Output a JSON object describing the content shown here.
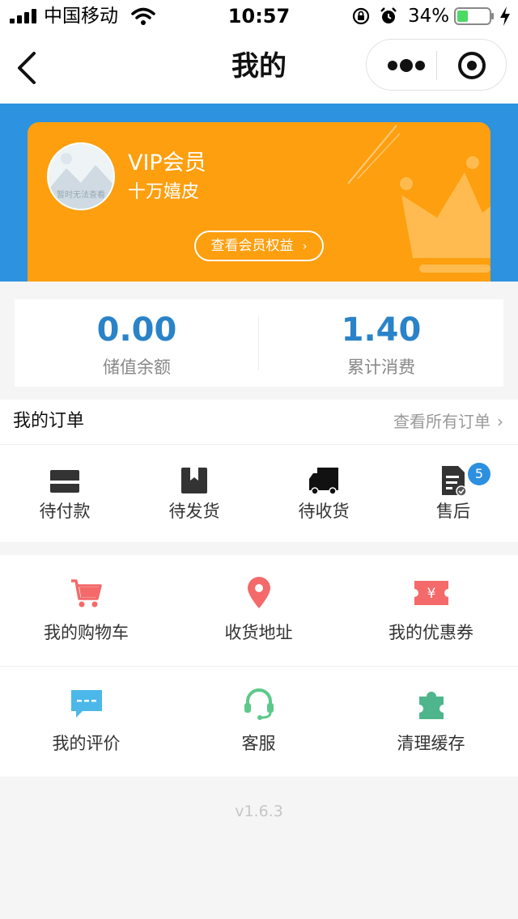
{
  "status_bar": {
    "carrier": "中国移动",
    "time": "10:57",
    "battery_percent": "34%",
    "battery_level": 0.34,
    "battery_color": "#4cd964"
  },
  "nav": {
    "title": "我的",
    "back_icon": "chevron-left-icon",
    "more_icon": "more-dots-icon",
    "close_icon": "target-close-icon"
  },
  "vip": {
    "avatar_placeholder": "暂时无法查看",
    "title": "VIP会员",
    "name": "十万嬉皮",
    "benefits_label": "查看会员权益",
    "card_color": "#fd9f0f",
    "band_color": "#2d92df"
  },
  "stats": [
    {
      "value": "0.00",
      "label": "储值余额"
    },
    {
      "value": "1.40",
      "label": "累计消费"
    }
  ],
  "orders": {
    "title": "我的订单",
    "view_all": "查看所有订单",
    "items": [
      {
        "label": "待付款",
        "icon": "card-icon"
      },
      {
        "label": "待发货",
        "icon": "box-icon"
      },
      {
        "label": "待收货",
        "icon": "truck-icon"
      },
      {
        "label": "售后",
        "icon": "document-icon",
        "badge": "5"
      }
    ]
  },
  "menu": [
    {
      "label": "我的购物车",
      "icon": "cart-icon",
      "color": "#f46a6a"
    },
    {
      "label": "收货地址",
      "icon": "location-pin-icon",
      "color": "#f46a6a"
    },
    {
      "label": "我的优惠券",
      "icon": "coupon-icon",
      "color": "#f46a6a"
    },
    {
      "label": "我的评价",
      "icon": "comment-icon",
      "color": "#4cb8ea"
    },
    {
      "label": "客服",
      "icon": "headset-icon",
      "color": "#5cc98a"
    },
    {
      "label": "清理缓存",
      "icon": "puzzle-icon",
      "color": "#4fb58d"
    }
  ],
  "version": "v1.6.3"
}
